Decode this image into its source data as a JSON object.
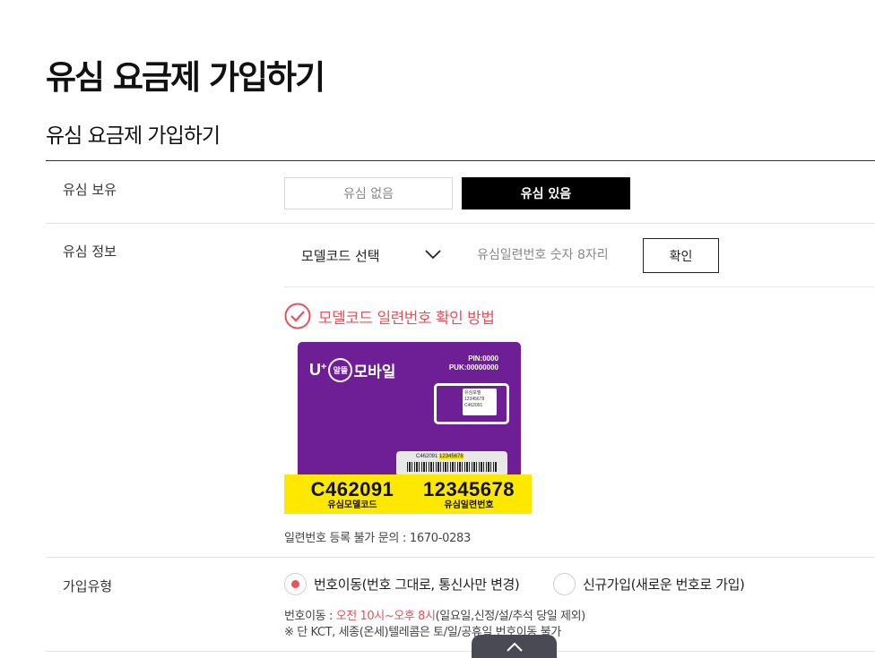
{
  "page": {
    "title": "유심 요금제 가입하기",
    "section_title": "유심 요금제 가입하기"
  },
  "usim_ownership": {
    "label": "유심 보유",
    "options": [
      "유심 없음",
      "유심 있음"
    ],
    "selected": "유심 있음"
  },
  "usim_info": {
    "label": "유심 정보",
    "model_select_value": "모델코드 선택",
    "serial_placeholder": "유심일련번호 숫자 8자리",
    "confirm_label": "확인",
    "howto_label": "모델코드 일련번호 확인 방법",
    "sim_card": {
      "brand": "U⁺알뜰모바일",
      "brand_prefix": "U",
      "brand_circle": "알뜰",
      "brand_suffix": "모바일",
      "pin": "PIN:0000",
      "puk": "PUK:00000000",
      "chip_model_prefix": "유심모델",
      "chip_serial": "12345678",
      "chip_code": "C462091",
      "barcode_model": "C462091",
      "barcode_serial": "12345678",
      "model_code": "C462091",
      "model_code_caption": "유심모델코드",
      "serial_number": "12345678",
      "serial_number_caption": "유심일련번호"
    },
    "inquiry_text": "일련번호 등록 불가 문의 : 1670-0283"
  },
  "join_type": {
    "label": "가입유형",
    "options": [
      {
        "label": "번호이동(번호 그대로, 통신사만 변경)",
        "selected": true
      },
      {
        "label": "신규가입(새로운 번호로 가입)",
        "selected": false
      }
    ],
    "note_prefix": "번호이동 : ",
    "note_hours": "오전 10시~오후 8시",
    "note_suffix": "(일요일,신정/설/추석 당일 제외)",
    "note_line2": "※ 단 KCT, 세종(온세)텔레콤은 토/일/공휴일 번호이동 불가"
  },
  "colors": {
    "accent_red": "#e8505b",
    "sim_purple": "#6e1f96",
    "band_yellow": "#ffe800",
    "selected_button": "#000000"
  }
}
